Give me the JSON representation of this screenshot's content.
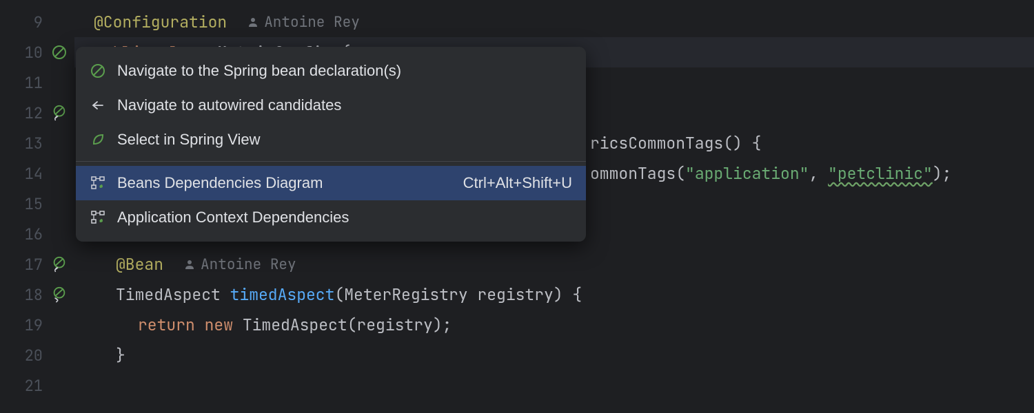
{
  "gutter": {
    "lines": [
      "9",
      "10",
      "11",
      "12",
      "13",
      "14",
      "15",
      "16",
      "17",
      "18",
      "19",
      "20",
      "21"
    ]
  },
  "code": {
    "line9": {
      "anno": "@Configuration",
      "author": "Antoine Rey"
    },
    "line10": {
      "kw1": "public",
      "kw2": "class",
      "cls": "MetricConfig",
      "brace": " {"
    },
    "line13": {
      "methodtail": "ricsCommonTags() {"
    },
    "line14": {
      "tail1": "ommonTags(",
      "s1": "\"application\"",
      "comma": ", ",
      "s2": "\"petclinic\"",
      "end": ");"
    },
    "line17": {
      "anno": "@Bean",
      "author": "Antoine Rey"
    },
    "line18": {
      "type": "TimedAspect ",
      "method": "timedAspect",
      "params": "(MeterRegistry registry) {"
    },
    "line19": {
      "kw1": "return",
      "sp": " ",
      "kw2": "new",
      "call": " TimedAspect(registry);"
    },
    "line20": {
      "brace": "}"
    }
  },
  "popup": {
    "items": [
      {
        "label": "Navigate to the Spring bean declaration(s)"
      },
      {
        "label": "Navigate to autowired candidates"
      },
      {
        "label": "Select in Spring View"
      },
      {
        "label": "Beans Dependencies Diagram",
        "shortcut": "Ctrl+Alt+Shift+U"
      },
      {
        "label": "Application Context Dependencies"
      }
    ]
  }
}
